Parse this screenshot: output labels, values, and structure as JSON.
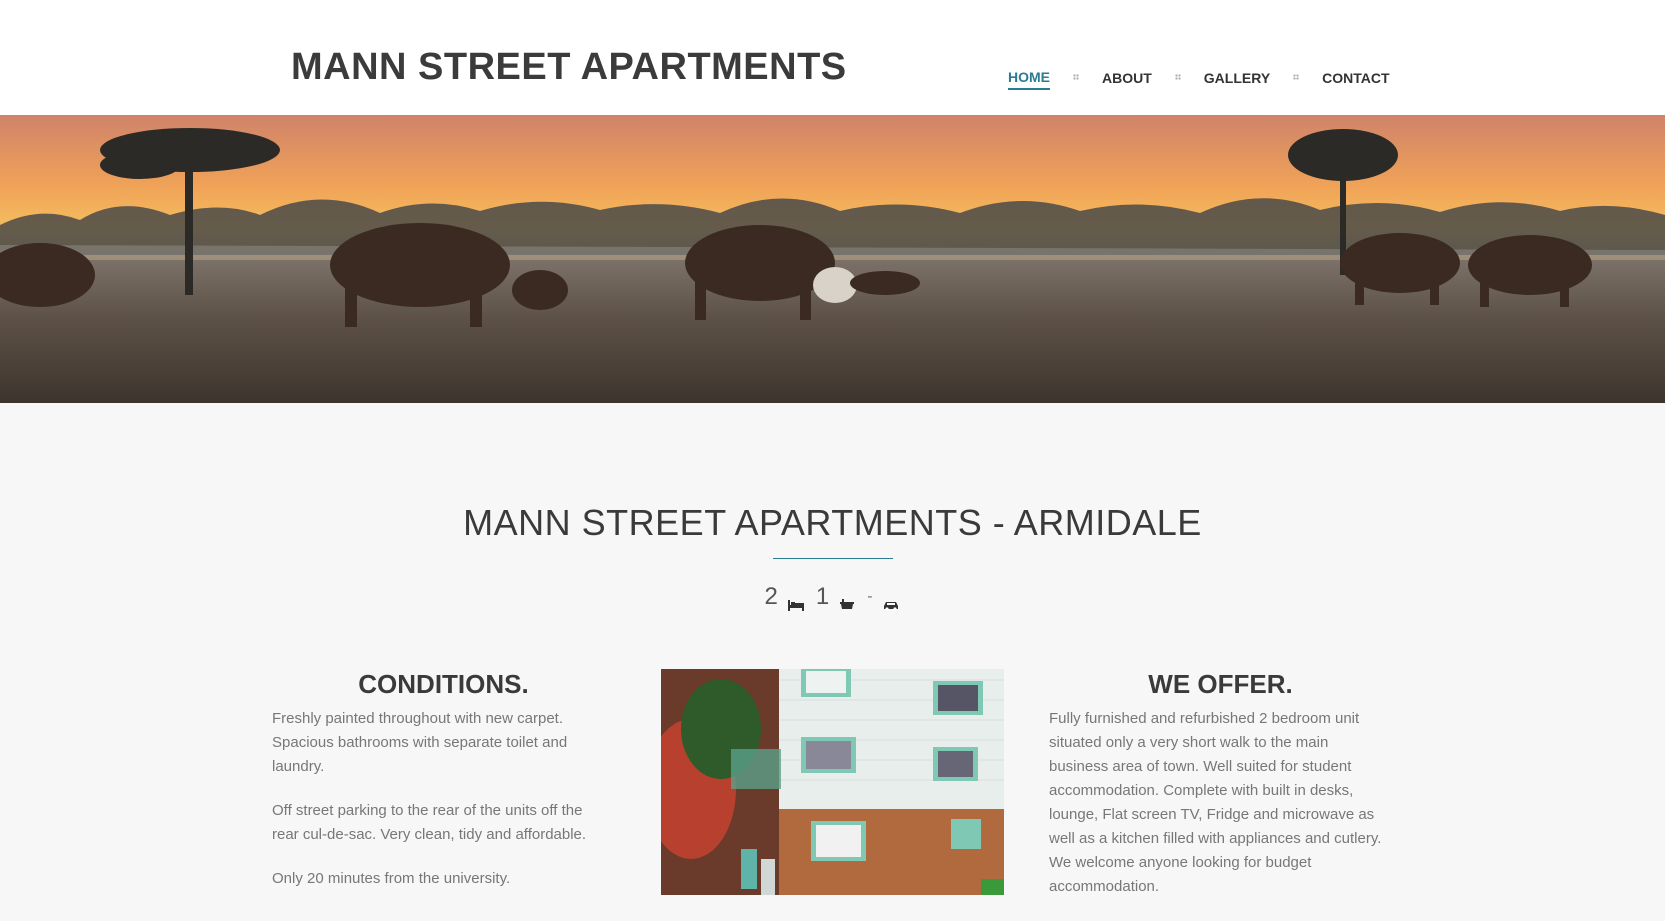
{
  "header": {
    "site_title": "MANN STREET APARTMENTS",
    "nav": [
      {
        "label": "HOME",
        "active": true
      },
      {
        "label": "ABOUT",
        "active": false
      },
      {
        "label": "GALLERY",
        "active": false
      },
      {
        "label": "CONTACT",
        "active": false
      }
    ]
  },
  "hero": {
    "icon": "sunset-cattle-photo"
  },
  "main": {
    "title": "MANN STREET APARTMENTS - ARMIDALE",
    "features": {
      "bedrooms": "2",
      "bathrooms": "1",
      "parking": "-",
      "bed_icon": "bed-icon",
      "bath_icon": "bath-icon",
      "car_icon": "car-icon"
    },
    "conditions": {
      "heading": "CONDITIONS.",
      "paragraphs": [
        "Freshly painted throughout with new carpet. Spacious bathrooms with separate toilet and laundry.",
        "Off street parking to the rear of the units off the rear cul-de-sac. Very clean, tidy and affordable.",
        "Only 20 minutes from the university."
      ]
    },
    "photo": {
      "icon": "apartment-building-photo"
    },
    "offer": {
      "heading": "WE OFFER.",
      "text": "Fully furnished and refurbished 2 bedroom unit situated only a very short walk to the main business area of town. Well suited for student accommodation. Complete with built in desks, lounge, Flat screen TV, Fridge and microwave as well as a kitchen filled with appliances and cutlery. We welcome anyone looking for budget accommodation."
    }
  },
  "colors": {
    "accent": "#2a7d8f",
    "text": "#333333",
    "muted": "#777777"
  }
}
